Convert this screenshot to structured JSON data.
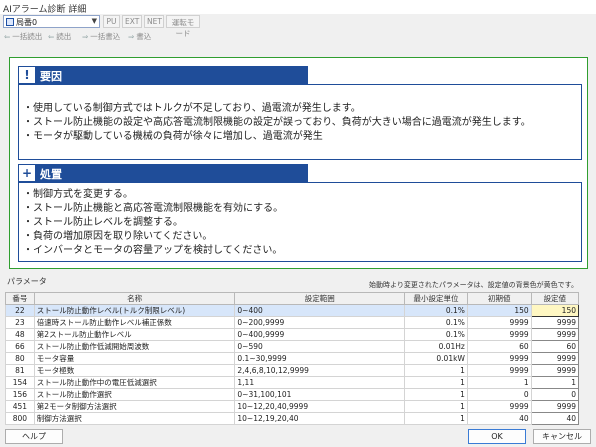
{
  "window": {
    "title": "AIアラーム診断 詳細"
  },
  "toolbar": {
    "axis_select": "局番0",
    "buttons": [
      "PU",
      "EXT",
      "NET",
      "運転モード"
    ],
    "actions": [
      "一括読出",
      "読出",
      "一括書込",
      "書込"
    ]
  },
  "cause": {
    "heading": "要因",
    "icon_char": "!",
    "lines": [
      "・使用している制御方式ではトルクが不足しており、過電流が発生します。",
      "・ストール防止機能の設定や高応答電流制限機能の設定が誤っており、負荷が大きい場合に過電流が発生します。",
      "・モータが駆動している機械の負荷が徐々に増加し、過電流が発生"
    ]
  },
  "action": {
    "heading": "処置",
    "icon_char": "+",
    "lines": [
      "・制御方式を変更する。",
      "・ストール防止機能と高応答電流制限機能を有効にする。",
      "・ストール防止レベルを調整する。",
      "・負荷の増加原因を取り除いてください。",
      "・インバータとモータの容量アップを検討してください。"
    ]
  },
  "params": {
    "label": "パラメータ",
    "note": "始動時より変更されたパラメータは、設定値の背景色が黄色です。",
    "columns": [
      "番号",
      "名称",
      "設定範囲",
      "最小設定単位",
      "初期値",
      "設定値"
    ],
    "rows": [
      {
        "no": "22",
        "name": "ストール防止動作レベル(トルク制限レベル)",
        "range": "0~400",
        "unit": "0.1%",
        "initial": "150",
        "value": "150"
      },
      {
        "no": "23",
        "name": "倍速時ストール防止動作レベル補正係数",
        "range": "0~200,9999",
        "unit": "0.1%",
        "initial": "9999",
        "value": "9999"
      },
      {
        "no": "48",
        "name": "第2ストール防止動作レベル",
        "range": "0~400,9999",
        "unit": "0.1%",
        "initial": "9999",
        "value": "9999"
      },
      {
        "no": "66",
        "name": "ストール防止動作低減開始周波数",
        "range": "0~590",
        "unit": "0.01Hz",
        "initial": "60",
        "value": "60"
      },
      {
        "no": "80",
        "name": "モータ容量",
        "range": "0.1~30,9999",
        "unit": "0.01kW",
        "initial": "9999",
        "value": "9999"
      },
      {
        "no": "81",
        "name": "モータ極数",
        "range": "2,4,6,8,10,12,9999",
        "unit": "1",
        "initial": "9999",
        "value": "9999"
      },
      {
        "no": "154",
        "name": "ストール防止動作中の電圧低減選択",
        "range": "1,11",
        "unit": "1",
        "initial": "1",
        "value": "1"
      },
      {
        "no": "156",
        "name": "ストール防止動作選択",
        "range": "0~31,100,101",
        "unit": "1",
        "initial": "0",
        "value": "0"
      },
      {
        "no": "451",
        "name": "第2モータ制御方法選択",
        "range": "10~12,20,40,9999",
        "unit": "1",
        "initial": "9999",
        "value": "9999"
      },
      {
        "no": "800",
        "name": "制御方法選択",
        "range": "10~12,19,20,40",
        "unit": "1",
        "initial": "40",
        "value": "40"
      }
    ]
  },
  "footer": {
    "help": "ヘルプ",
    "ok": "OK",
    "cancel": "キャンセル"
  }
}
